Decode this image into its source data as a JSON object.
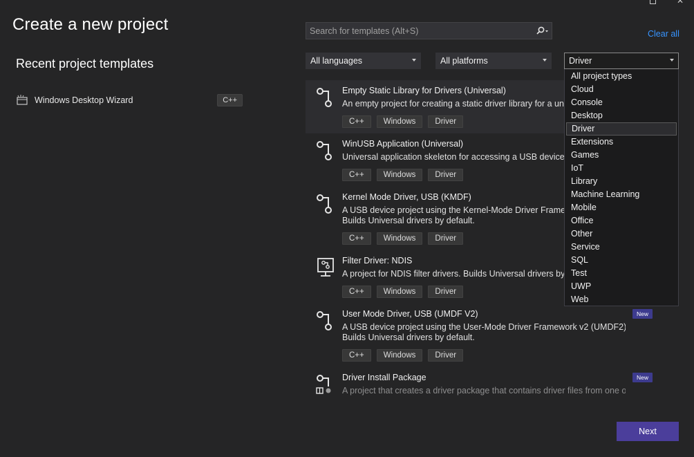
{
  "page": {
    "title": "Create a new project",
    "recent_title": "Recent project templates",
    "next_label": "Next"
  },
  "recent": {
    "items": [
      {
        "label": "Windows Desktop Wizard",
        "tag": "C++",
        "icon": "wizard-icon"
      }
    ]
  },
  "search": {
    "placeholder": "Search for templates (Alt+S)",
    "icon": "search-icon"
  },
  "filters": {
    "clear_all": "Clear all",
    "language": "All languages",
    "platform": "All platforms",
    "project_type": "Driver",
    "project_type_options": [
      "All project types",
      "Cloud",
      "Console",
      "Desktop",
      "Driver",
      "Extensions",
      "Games",
      "IoT",
      "Library",
      "Machine Learning",
      "Mobile",
      "Office",
      "Other",
      "Service",
      "SQL",
      "Test",
      "UWP",
      "Web"
    ],
    "selected_index": 4
  },
  "templates": [
    {
      "title": "Empty Static Library for Drivers (Universal)",
      "desc": "An empty project for creating a static driver library for a universal driver.",
      "desc2": "",
      "tags": [
        "C++",
        "Windows",
        "Driver"
      ],
      "new": "",
      "icon": "driver-icon"
    },
    {
      "title": "WinUSB Application (Universal)",
      "desc": "Universal application skeleton for accessing a USB device",
      "desc2": "",
      "tags": [
        "C++",
        "Windows",
        "Driver"
      ],
      "new": "",
      "icon": "driver-icon"
    },
    {
      "title": "Kernel Mode Driver, USB (KMDF)",
      "desc": "A USB device project using the Kernel-Mode Driver Framework (KMDF).",
      "desc2": "Builds Universal drivers by default.",
      "tags": [
        "C++",
        "Windows",
        "Driver"
      ],
      "new": "",
      "icon": "driver-icon"
    },
    {
      "title": "Filter Driver: NDIS",
      "desc": "A project for NDIS filter drivers. Builds Universal drivers by default.",
      "desc2": "",
      "tags": [
        "C++",
        "Windows",
        "Driver"
      ],
      "new": "",
      "icon": "network-filter-icon"
    },
    {
      "title": "User Mode Driver, USB (UMDF V2)",
      "desc": "A USB device project using the User-Mode Driver Framework v2 (UMDF2).",
      "desc2": "Builds Universal drivers by default.",
      "tags": [
        "C++",
        "Windows",
        "Driver"
      ],
      "new": "New",
      "icon": "driver-icon"
    },
    {
      "title": "Driver Install Package",
      "desc": "A project that creates a driver package that contains driver files from one or",
      "desc2": "",
      "tags": [],
      "new": "New",
      "icon": "driver-package-icon"
    }
  ]
}
